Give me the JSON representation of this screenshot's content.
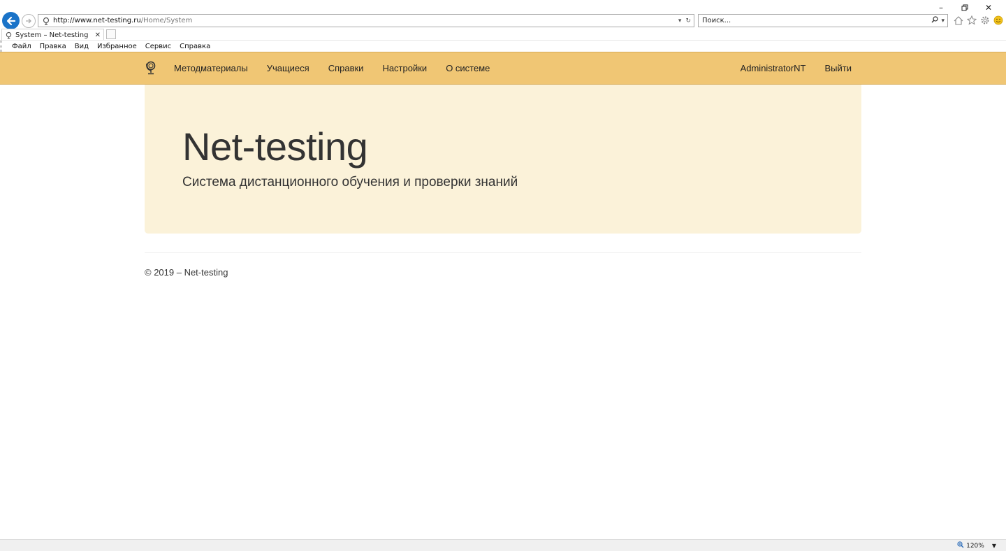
{
  "browser": {
    "url_host": "http://www.net-testing.ru",
    "url_path": "/Home/System",
    "search_placeholder": "Поиск...",
    "tab_title": "System – Net-testing",
    "menu": [
      "Файл",
      "Правка",
      "Вид",
      "Избранное",
      "Сервис",
      "Справка"
    ],
    "zoom_label": "120%",
    "icons": [
      "back-arrow-icon",
      "forward-arrow-icon",
      "site-globe-icon",
      "refresh-icon",
      "search-icon",
      "home-icon",
      "favorites-star-icon",
      "gear-icon",
      "smiley-icon",
      "magnifier-zoom-icon"
    ]
  },
  "navbar": {
    "links": [
      "Методматериалы",
      "Учащиеся",
      "Справки",
      "Настройки",
      "О системе"
    ],
    "user": "AdministratorNT",
    "logout": "Выйти",
    "bg_color": "#f0c674"
  },
  "jumbotron": {
    "title": "Net-testing",
    "subtitle": "Система дистанционного обучения и проверки знаний",
    "bg_color": "#fbf2d9"
  },
  "footer": {
    "text": "© 2019 – Net-testing"
  }
}
